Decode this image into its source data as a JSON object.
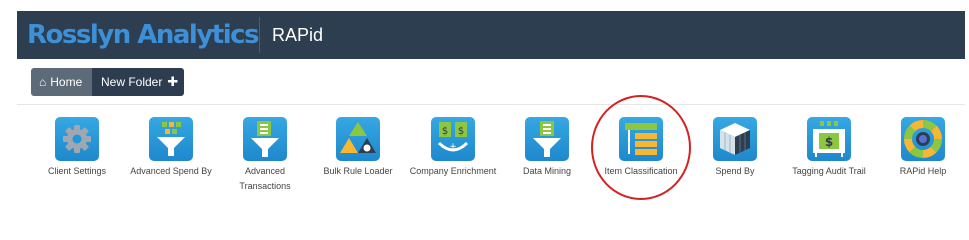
{
  "header": {
    "brand": "Rosslyn Analytics",
    "app_title": "RAPid"
  },
  "toolbar": {
    "home_label": "Home",
    "new_folder_label": "New Folder"
  },
  "tiles": [
    {
      "label": "Client Settings",
      "icon": "gear-icon"
    },
    {
      "label": "Advanced Spend By",
      "icon": "funnel-icon"
    },
    {
      "label": "Advanced Transactions",
      "icon": "funnel-icon"
    },
    {
      "label": "Bulk Rule Loader",
      "icon": "triangle-icon"
    },
    {
      "label": "Company Enrichment",
      "icon": "enrichment-icon"
    },
    {
      "label": "Data Mining",
      "icon": "funnel-icon"
    },
    {
      "label": "Item Classification",
      "icon": "classification-icon"
    },
    {
      "label": "Spend By",
      "icon": "cube-icon"
    },
    {
      "label": "Tagging Audit Trail",
      "icon": "audit-icon"
    },
    {
      "label": "RAPid Help",
      "icon": "lifebuoy-icon"
    }
  ],
  "colors": {
    "header_bg": "#2c3e50",
    "brand": "#3d8fd8",
    "tile_blue": "#2196d8",
    "annotation_circle": "#d42222"
  }
}
